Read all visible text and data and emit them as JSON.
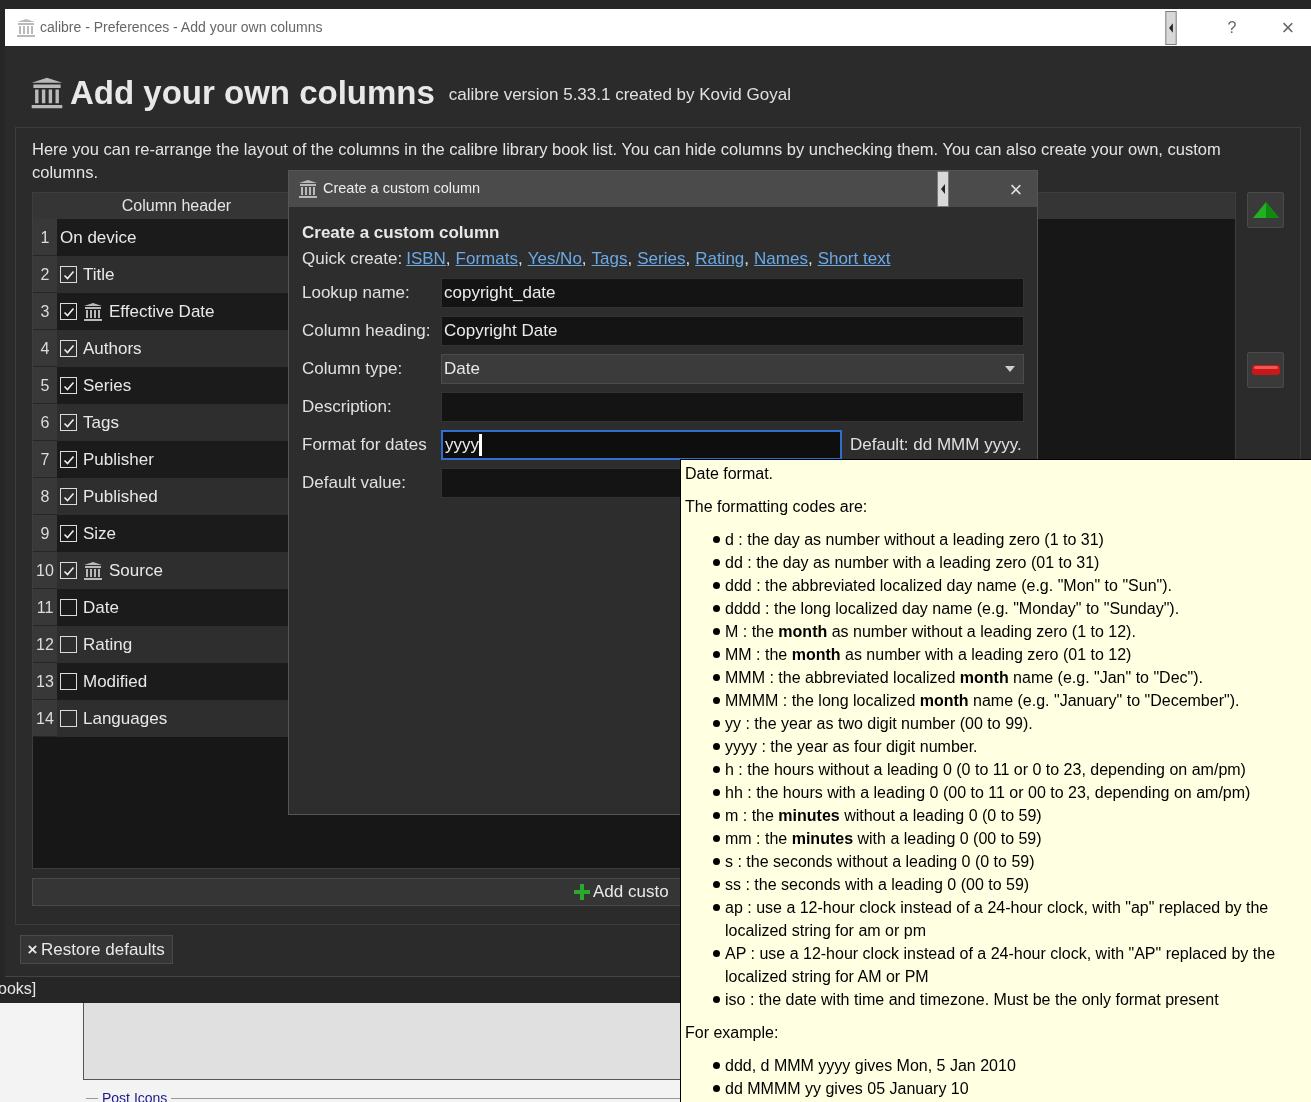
{
  "background_page": {
    "status_text": "ooks]",
    "legend": "Post Icons"
  },
  "window": {
    "title": "calibre - Preferences - Add your own columns",
    "help": "?",
    "close": "×"
  },
  "header": {
    "title": "Add your own columns",
    "subtitle": "calibre version 5.33.1 created by Kovid Goyal"
  },
  "description": "Here you can re-arrange the layout of the columns in the calibre library book list. You can hide columns by unchecking them. You can also create your own, custom columns.",
  "table": {
    "column_header": "Column header",
    "rows": [
      {
        "number": "1",
        "label": "On device",
        "kind": "plain"
      },
      {
        "number": "2",
        "label": "Title",
        "kind": "checkbox",
        "checked": true,
        "custom": false
      },
      {
        "number": "3",
        "label": "Effective Date",
        "kind": "checkbox",
        "checked": true,
        "custom": true
      },
      {
        "number": "4",
        "label": "Authors",
        "kind": "checkbox",
        "checked": true,
        "custom": false
      },
      {
        "number": "5",
        "label": "Series",
        "kind": "checkbox",
        "checked": true,
        "custom": false
      },
      {
        "number": "6",
        "label": "Tags",
        "kind": "checkbox",
        "checked": true,
        "custom": false
      },
      {
        "number": "7",
        "label": "Publisher",
        "kind": "checkbox",
        "checked": true,
        "custom": false
      },
      {
        "number": "8",
        "label": "Published",
        "kind": "checkbox",
        "checked": true,
        "custom": false
      },
      {
        "number": "9",
        "label": "Size",
        "kind": "checkbox",
        "checked": true,
        "custom": false
      },
      {
        "number": "10",
        "label": "Source",
        "kind": "checkbox",
        "checked": true,
        "custom": true
      },
      {
        "number": "11",
        "label": "Date",
        "kind": "checkbox",
        "checked": false,
        "custom": false
      },
      {
        "number": "12",
        "label": "Rating",
        "kind": "checkbox",
        "checked": false,
        "custom": false
      },
      {
        "number": "13",
        "label": "Modified",
        "kind": "checkbox",
        "checked": false,
        "custom": false
      },
      {
        "number": "14",
        "label": "Languages",
        "kind": "checkbox",
        "checked": false,
        "custom": false
      }
    ]
  },
  "add_button": "Add custo",
  "restore_button": "Restore defaults",
  "dialog": {
    "title": "Create a custom column",
    "close": "×",
    "heading": "Create a custom column",
    "quick_create_label": "Quick create:",
    "separator": ",",
    "quick_links": [
      "ISBN",
      "Formats",
      "Yes/No",
      "Tags",
      "Series",
      "Rating",
      "Names",
      "Short text"
    ],
    "fields": [
      {
        "label": "Lookup name:",
        "kind": "text",
        "value": "copyright_date"
      },
      {
        "label": "Column heading:",
        "kind": "text",
        "value": "Copyright Date"
      },
      {
        "label": "Column type:",
        "kind": "dropdown",
        "value": "Date"
      },
      {
        "label": "Description:",
        "kind": "text"
      },
      {
        "label": "Format for dates",
        "kind": "text",
        "value": "yyyy",
        "focused": true,
        "hint": "Default: dd MMM yyyy."
      },
      {
        "label": "Default value:",
        "kind": "text"
      }
    ]
  },
  "tooltip": {
    "title": "Date format.",
    "intro": "The formatting codes are:",
    "codes": [
      "d : the day as number without a leading zero (1 to 31)",
      "dd : the day as number with a leading zero (01 to 31)",
      "ddd : the abbreviated localized day name (e.g. \"Mon\" to \"Sun\").",
      "dddd : the long localized day name (e.g. \"Monday\" to \"Sunday\").",
      "M : the **month** as number without a leading zero (1 to 12).",
      "MM : the **month** as number with a leading zero (01 to 12)",
      "MMM : the abbreviated localized **month** name (e.g. \"Jan\" to \"Dec\").",
      "MMMM : the long localized **month** name (e.g. \"January\" to \"December\").",
      "yy : the year as two digit number (00 to 99).",
      "yyyy : the year as four digit number.",
      "h : the hours without a leading 0 (0 to 11 or 0 to 23, depending on am/pm)",
      "hh : the hours with a leading 0 (00 to 11 or 00 to 23, depending on am/pm)",
      "m : the **minutes** without a leading 0 (0 to 59)",
      "mm : the **minutes** with a leading 0 (00 to 59)",
      "s : the seconds without a leading 0 (0 to 59)",
      "ss : the seconds with a leading 0 (00 to 59)",
      "ap : use a 12-hour clock instead of a 24-hour clock, with \"ap\" replaced by the localized string for am or pm",
      "AP : use a 12-hour clock instead of a 24-hour clock, with \"AP\" replaced by the localized string for AM or PM",
      "iso : the date with time and timezone. Must be the only format present"
    ],
    "example_label": "For example:",
    "examples": [
      "ddd, d MMM yyyy gives Mon, 5 Jan 2010",
      "dd MMMM yy gives 05 January 10"
    ]
  }
}
